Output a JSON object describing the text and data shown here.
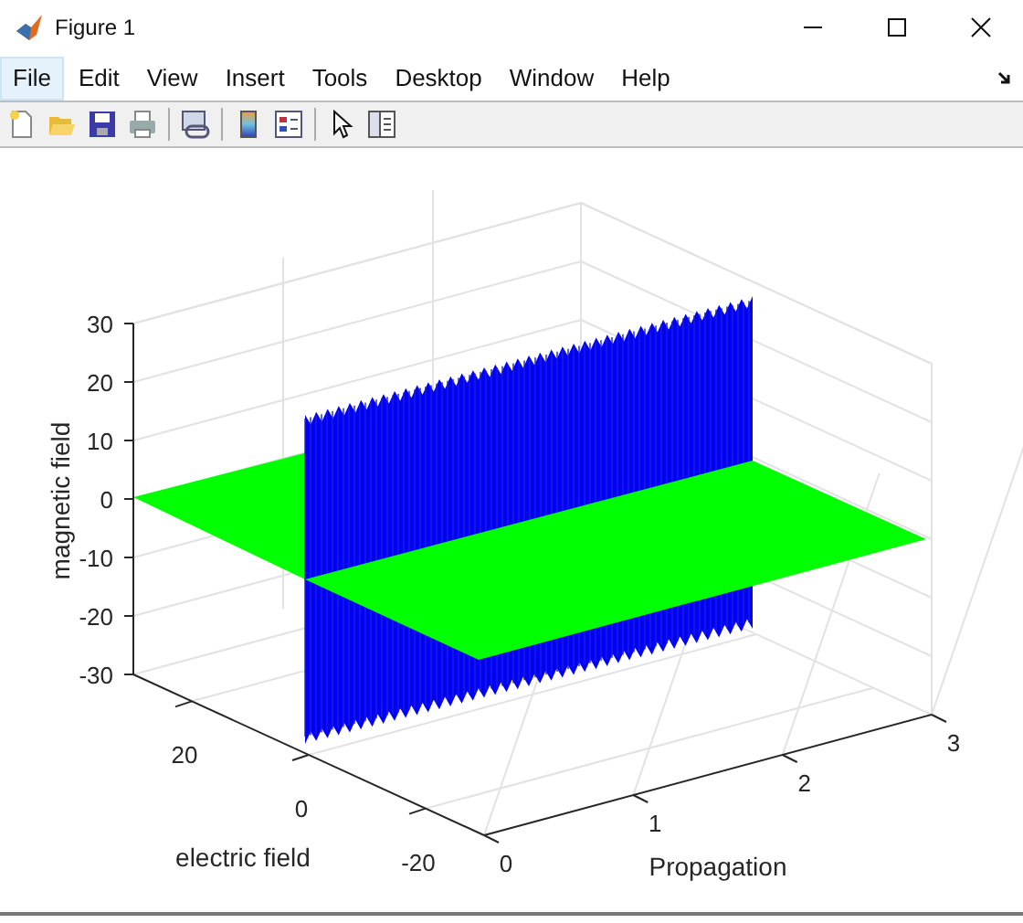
{
  "window": {
    "title": "Figure 1"
  },
  "menu": [
    {
      "label": "File",
      "selected": true
    },
    {
      "label": "Edit",
      "selected": false
    },
    {
      "label": "View",
      "selected": false
    },
    {
      "label": "Insert",
      "selected": false
    },
    {
      "label": "Tools",
      "selected": false
    },
    {
      "label": "Desktop",
      "selected": false
    },
    {
      "label": "Window",
      "selected": false
    },
    {
      "label": "Help",
      "selected": false
    }
  ],
  "plot": {
    "zlabel": "magnetic field",
    "ylabel": "electric field",
    "xlabel": "Propagation",
    "z_ticks": [
      "30",
      "20",
      "10",
      "0",
      "-10",
      "-20",
      "-30"
    ],
    "y_ticks": [
      "20",
      "0",
      "-20"
    ],
    "x_ticks": [
      "0",
      "1",
      "2",
      "3"
    ]
  }
}
